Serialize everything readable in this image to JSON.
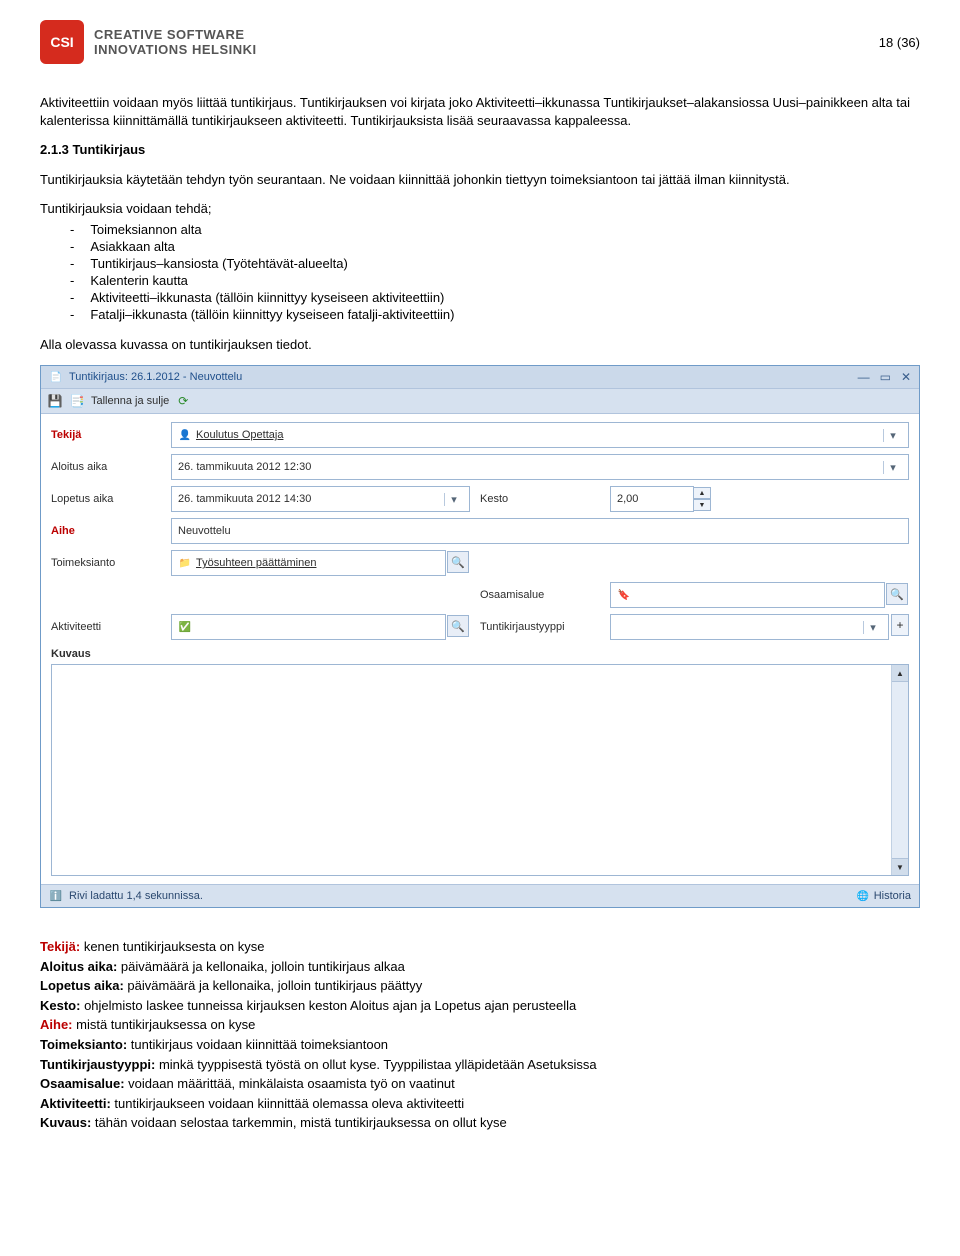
{
  "page_num": "18 (36)",
  "logo_text_line1": "CREATIVE SOFTWARE",
  "logo_text_line2": "INNOVATIONS HELSINKI",
  "logo_abbr": "CSI",
  "intro": {
    "p1": "Aktiviteettiin voidaan myös liittää tuntikirjaus. Tuntikirjauksen voi kirjata joko Aktiviteetti–ikkunassa Tuntikirjaukset–alakansiossa Uusi–painikkeen alta tai kalenterissa kiinnittämällä tuntikirjaukseen aktiviteetti. Tuntikirjauksista lisää seuraavassa kappaleessa."
  },
  "section": {
    "heading": "2.1.3   Tuntikirjaus",
    "p1": "Tuntikirjauksia käytetään tehdyn työn seurantaan. Ne voidaan kiinnittää johonkin tiettyyn toimeksiantoon tai jättää ilman kiinnitystä.",
    "list_intro": "Tuntikirjauksia voidaan tehdä;",
    "items": [
      "Toimeksiannon alta",
      "Asiakkaan alta",
      "Tuntikirjaus–kansiosta (Työtehtävät-alueelta)",
      "Kalenterin kautta",
      "Aktiviteetti–ikkunasta (tällöin kiinnittyy kyseiseen aktiviteettiin)",
      "Fatalji–ikkunasta (tällöin kiinnittyy kyseiseen fatalji-aktiviteettiin)"
    ],
    "caption": "Alla olevassa kuvassa on tuntikirjauksen tiedot."
  },
  "win": {
    "title": "Tuntikirjaus: 26.1.2012 - Neuvottelu",
    "toolbar_save": "Tallenna ja sulje",
    "labels": {
      "tekija": "Tekijä",
      "aloitus": "Aloitus aika",
      "lopetus": "Lopetus aika",
      "kesto": "Kesto",
      "aihe": "Aihe",
      "toimeksianto": "Toimeksianto",
      "osaamisalue": "Osaamisalue",
      "aktiviteetti": "Aktiviteetti",
      "tuntityyppi": "Tuntikirjaustyyppi",
      "kuvaus": "Kuvaus"
    },
    "values": {
      "tekija": "Koulutus Opettaja",
      "aloitus": "26. tammikuuta 2012 12:30",
      "lopetus": "26. tammikuuta 2012 14:30",
      "kesto": "2,00",
      "aihe": "Neuvottelu",
      "toimeksianto": "Työsuhteen päättäminen",
      "osaamisalue": "",
      "aktiviteetti": "",
      "tuntityyppi": ""
    },
    "status": "Rivi ladattu 1,4 sekunnissa.",
    "historia": "Historia"
  },
  "defs": {
    "tekija_l": "Tekijä:",
    "tekija_t": " kenen tuntikirjauksesta on kyse",
    "aloitus_l": "Aloitus aika:",
    "aloitus_t": " päivämäärä ja kellonaika, jolloin tuntikirjaus alkaa",
    "lopetus_l": "Lopetus aika:",
    "lopetus_t": " päivämäärä ja kellonaika, jolloin tuntikirjaus päättyy",
    "kesto_l": "Kesto:",
    "kesto_t": " ohjelmisto laskee tunneissa kirjauksen keston Aloitus ajan ja Lopetus ajan perusteella",
    "aihe_l": "Aihe:",
    "aihe_t": " mistä tuntikirjauksessa on kyse",
    "toim_l": "Toimeksianto:",
    "toim_t": " tuntikirjaus voidaan kiinnittää toimeksiantoon",
    "tyyppi_l": "Tuntikirjaustyyppi:",
    "tyyppi_t": " minkä tyyppisestä työstä on ollut kyse. Tyyppilistaa ylläpidetään Asetuksissa",
    "osaa_l": "Osaamisalue:",
    "osaa_t": " voidaan määrittää, minkälaista osaamista työ on vaatinut",
    "akti_l": "Aktiviteetti:",
    "akti_t": " tuntikirjaukseen voidaan kiinnittää olemassa oleva aktiviteetti",
    "kuvaus_l": "Kuvaus:",
    "kuvaus_t": " tähän voidaan selostaa tarkemmin, mistä tuntikirjauksessa on ollut kyse"
  }
}
